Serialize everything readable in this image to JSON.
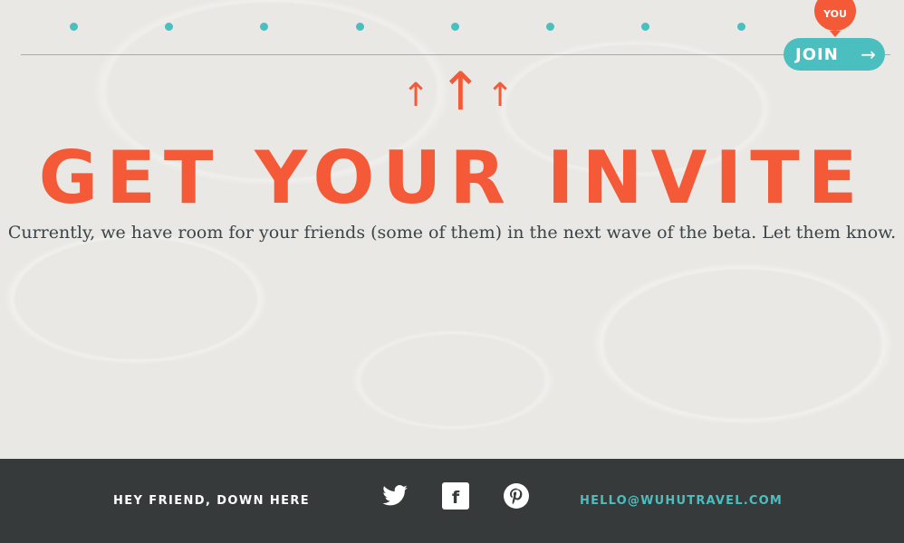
{
  "progress": {
    "step_count": 9,
    "current_step_label": "YOU"
  },
  "header": {
    "join_label": "JOIN",
    "join_arrow": "→"
  },
  "main": {
    "headline": "GET YOUR INVITE",
    "subtext": "Currently, we have room for your friends (some of them) in the next wave of the beta. Let them know."
  },
  "footer": {
    "tagline": "HEY FRIEND, DOWN HERE",
    "social": [
      "twitter-icon",
      "facebook-icon",
      "pinterest-icon"
    ],
    "email": "HELLO@WUHUTRAVEL.COM"
  },
  "colors": {
    "accent": "#f45a37",
    "teal": "#4bbfbf",
    "footer_bg": "#363a3a",
    "page_bg": "#e9e8e4"
  }
}
